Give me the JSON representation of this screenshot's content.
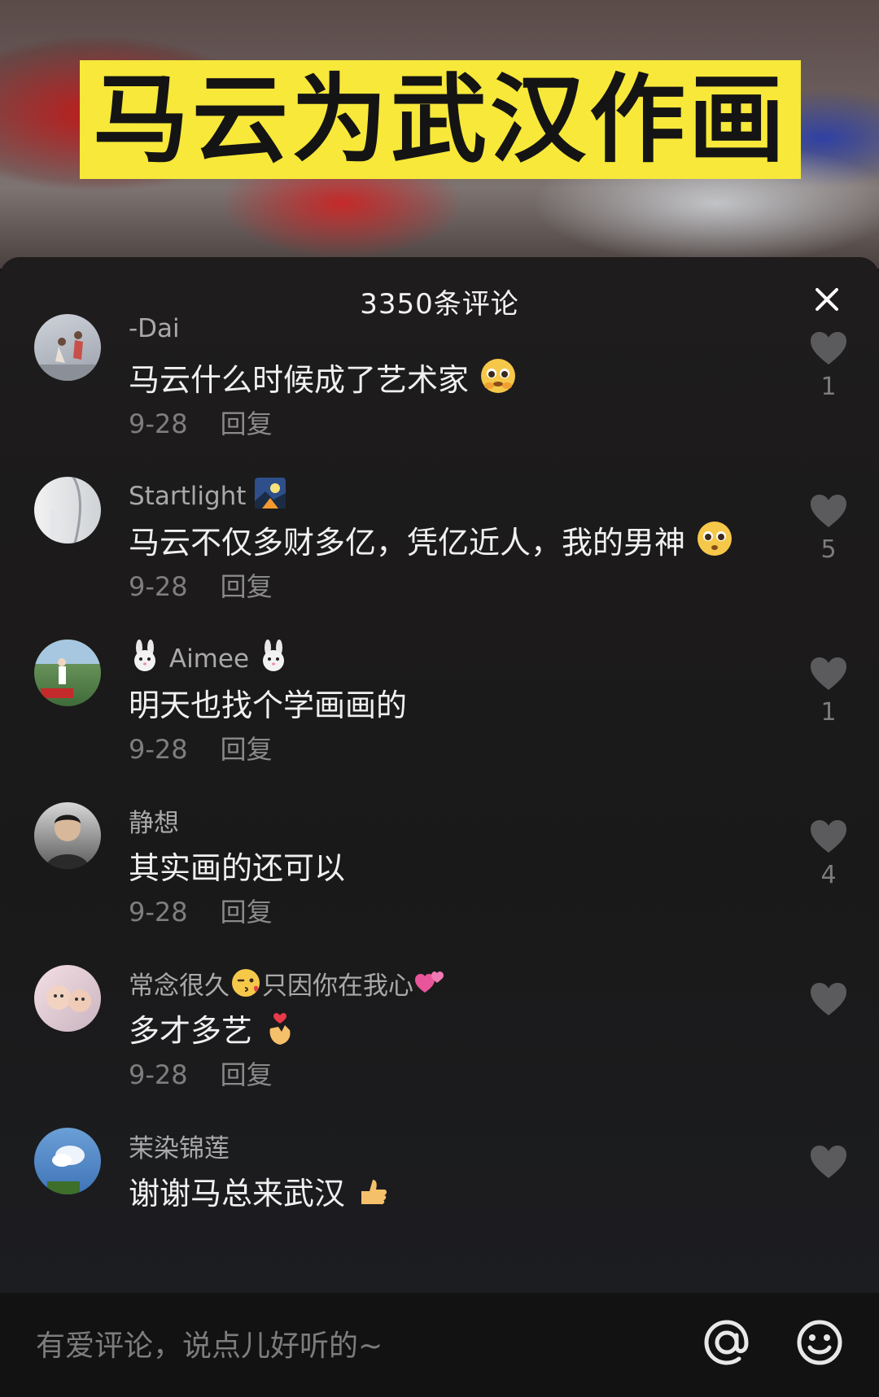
{
  "video": {
    "title": "马云为武汉作画"
  },
  "comments_panel": {
    "title": "3350条评论",
    "close_icon": "close-icon",
    "items": [
      {
        "user": "-Dai",
        "text": "马云什么时候成了艺术家",
        "text_emoji": "pleading-face-icon",
        "date": "9-28",
        "reply": "回复",
        "likes": "1",
        "avatar": "avatar-dancers"
      },
      {
        "user": "Startlight",
        "user_emoji": "night-landscape-icon",
        "text": "马云不仅多财多亿，凭亿近人，我的男神",
        "text_emoji": "pleading-face-icon",
        "date": "9-28",
        "reply": "回复",
        "likes": "5",
        "avatar": "avatar-white"
      },
      {
        "user_prefix_emoji": "rabbit-face-icon",
        "user": "Aimee",
        "user_emoji": "rabbit-face-icon",
        "text": "明天也找个学画画的",
        "date": "9-28",
        "reply": "回复",
        "likes": "1",
        "avatar": "avatar-golf"
      },
      {
        "user": "静想",
        "text": "其实画的还可以",
        "date": "9-28",
        "reply": "回复",
        "likes": "4",
        "avatar": "avatar-man"
      },
      {
        "user": "常念很久",
        "user_mid_emoji": "kissing-face-icon",
        "user_suffix": "只因你在我心",
        "user_emoji": "two-hearts-icon",
        "text": "多才多艺",
        "text_emoji": "heart-hands-icon",
        "date": "9-28",
        "reply": "回复",
        "likes": "",
        "avatar": "avatar-kids"
      },
      {
        "user": "茉染锦莲",
        "text": "谢谢马总来武汉",
        "text_emoji": "thumbs-icon",
        "date": "",
        "reply": "",
        "likes": "",
        "avatar": "avatar-sky"
      }
    ]
  },
  "bottom_bar": {
    "placeholder": "有爱评论，说点儿好听的~",
    "at_icon": "at-icon",
    "emoji_icon": "smile-icon"
  },
  "colors": {
    "banner": "#f7e83a",
    "sheet_bg": "#1c1a1a",
    "username": "#a9a9a9",
    "text": "#f0f0f0",
    "meta": "#7e7e7e"
  }
}
